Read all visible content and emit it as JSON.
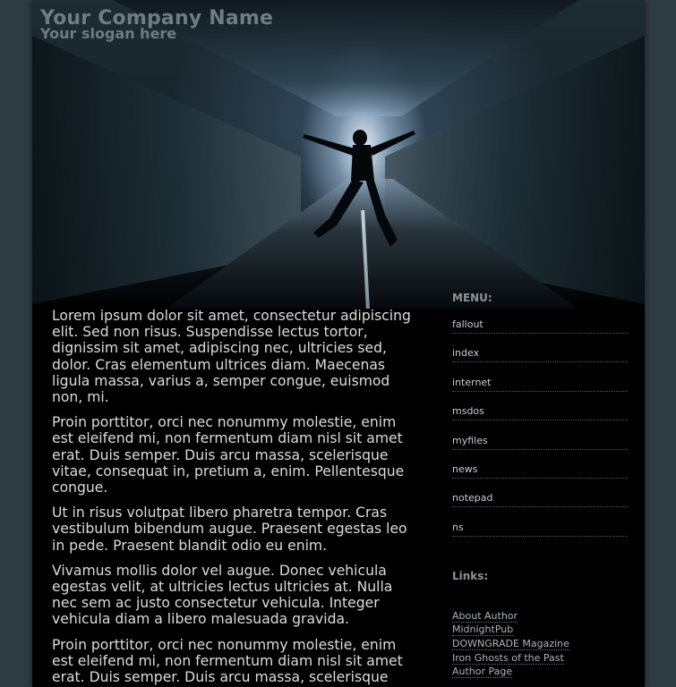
{
  "header": {
    "company": "Your Company Name",
    "slogan": "Your slogan here"
  },
  "content": {
    "paragraphs": [
      "Lorem ipsum dolor sit amet, consectetur adipiscing elit. Sed non risus. Suspendisse lectus tortor, dignissim sit amet, adipiscing nec, ultricies sed, dolor. Cras elementum ultrices diam. Maecenas ligula massa, varius a, semper congue, euismod non, mi.",
      "Proin porttitor, orci nec nonummy molestie, enim est eleifend mi, non fermentum diam nisl sit amet erat. Duis semper. Duis arcu massa, scelerisque vitae, consequat in, pretium a, enim. Pellentesque congue.",
      "Ut in risus volutpat libero pharetra tempor. Cras vestibulum bibendum augue. Praesent egestas leo in pede. Praesent blandit odio eu enim.",
      "Vivamus mollis dolor vel augue. Donec vehicula egestas velit, at ultricies lectus ultricies at. Nulla nec sem ac justo consectetur vehicula. Integer vehicula diam a libero malesuada gravida.",
      "Proin porttitor, orci nec nonummy molestie, enim est eleifend mi, non fermentum diam nisl sit amet erat. Duis semper. Duis arcu massa, scelerisque"
    ]
  },
  "sidebar": {
    "menu_heading": "MENU:",
    "menu_items": [
      "fallout",
      "index",
      "internet",
      "msdos",
      "myfiles",
      "news",
      "notepad",
      "ns"
    ],
    "links_heading": "Links:",
    "links": [
      "About Author",
      "MidnightPub",
      "DOWNGRADE Magazine",
      "Iron Ghosts of the Past",
      "Author Page"
    ]
  }
}
